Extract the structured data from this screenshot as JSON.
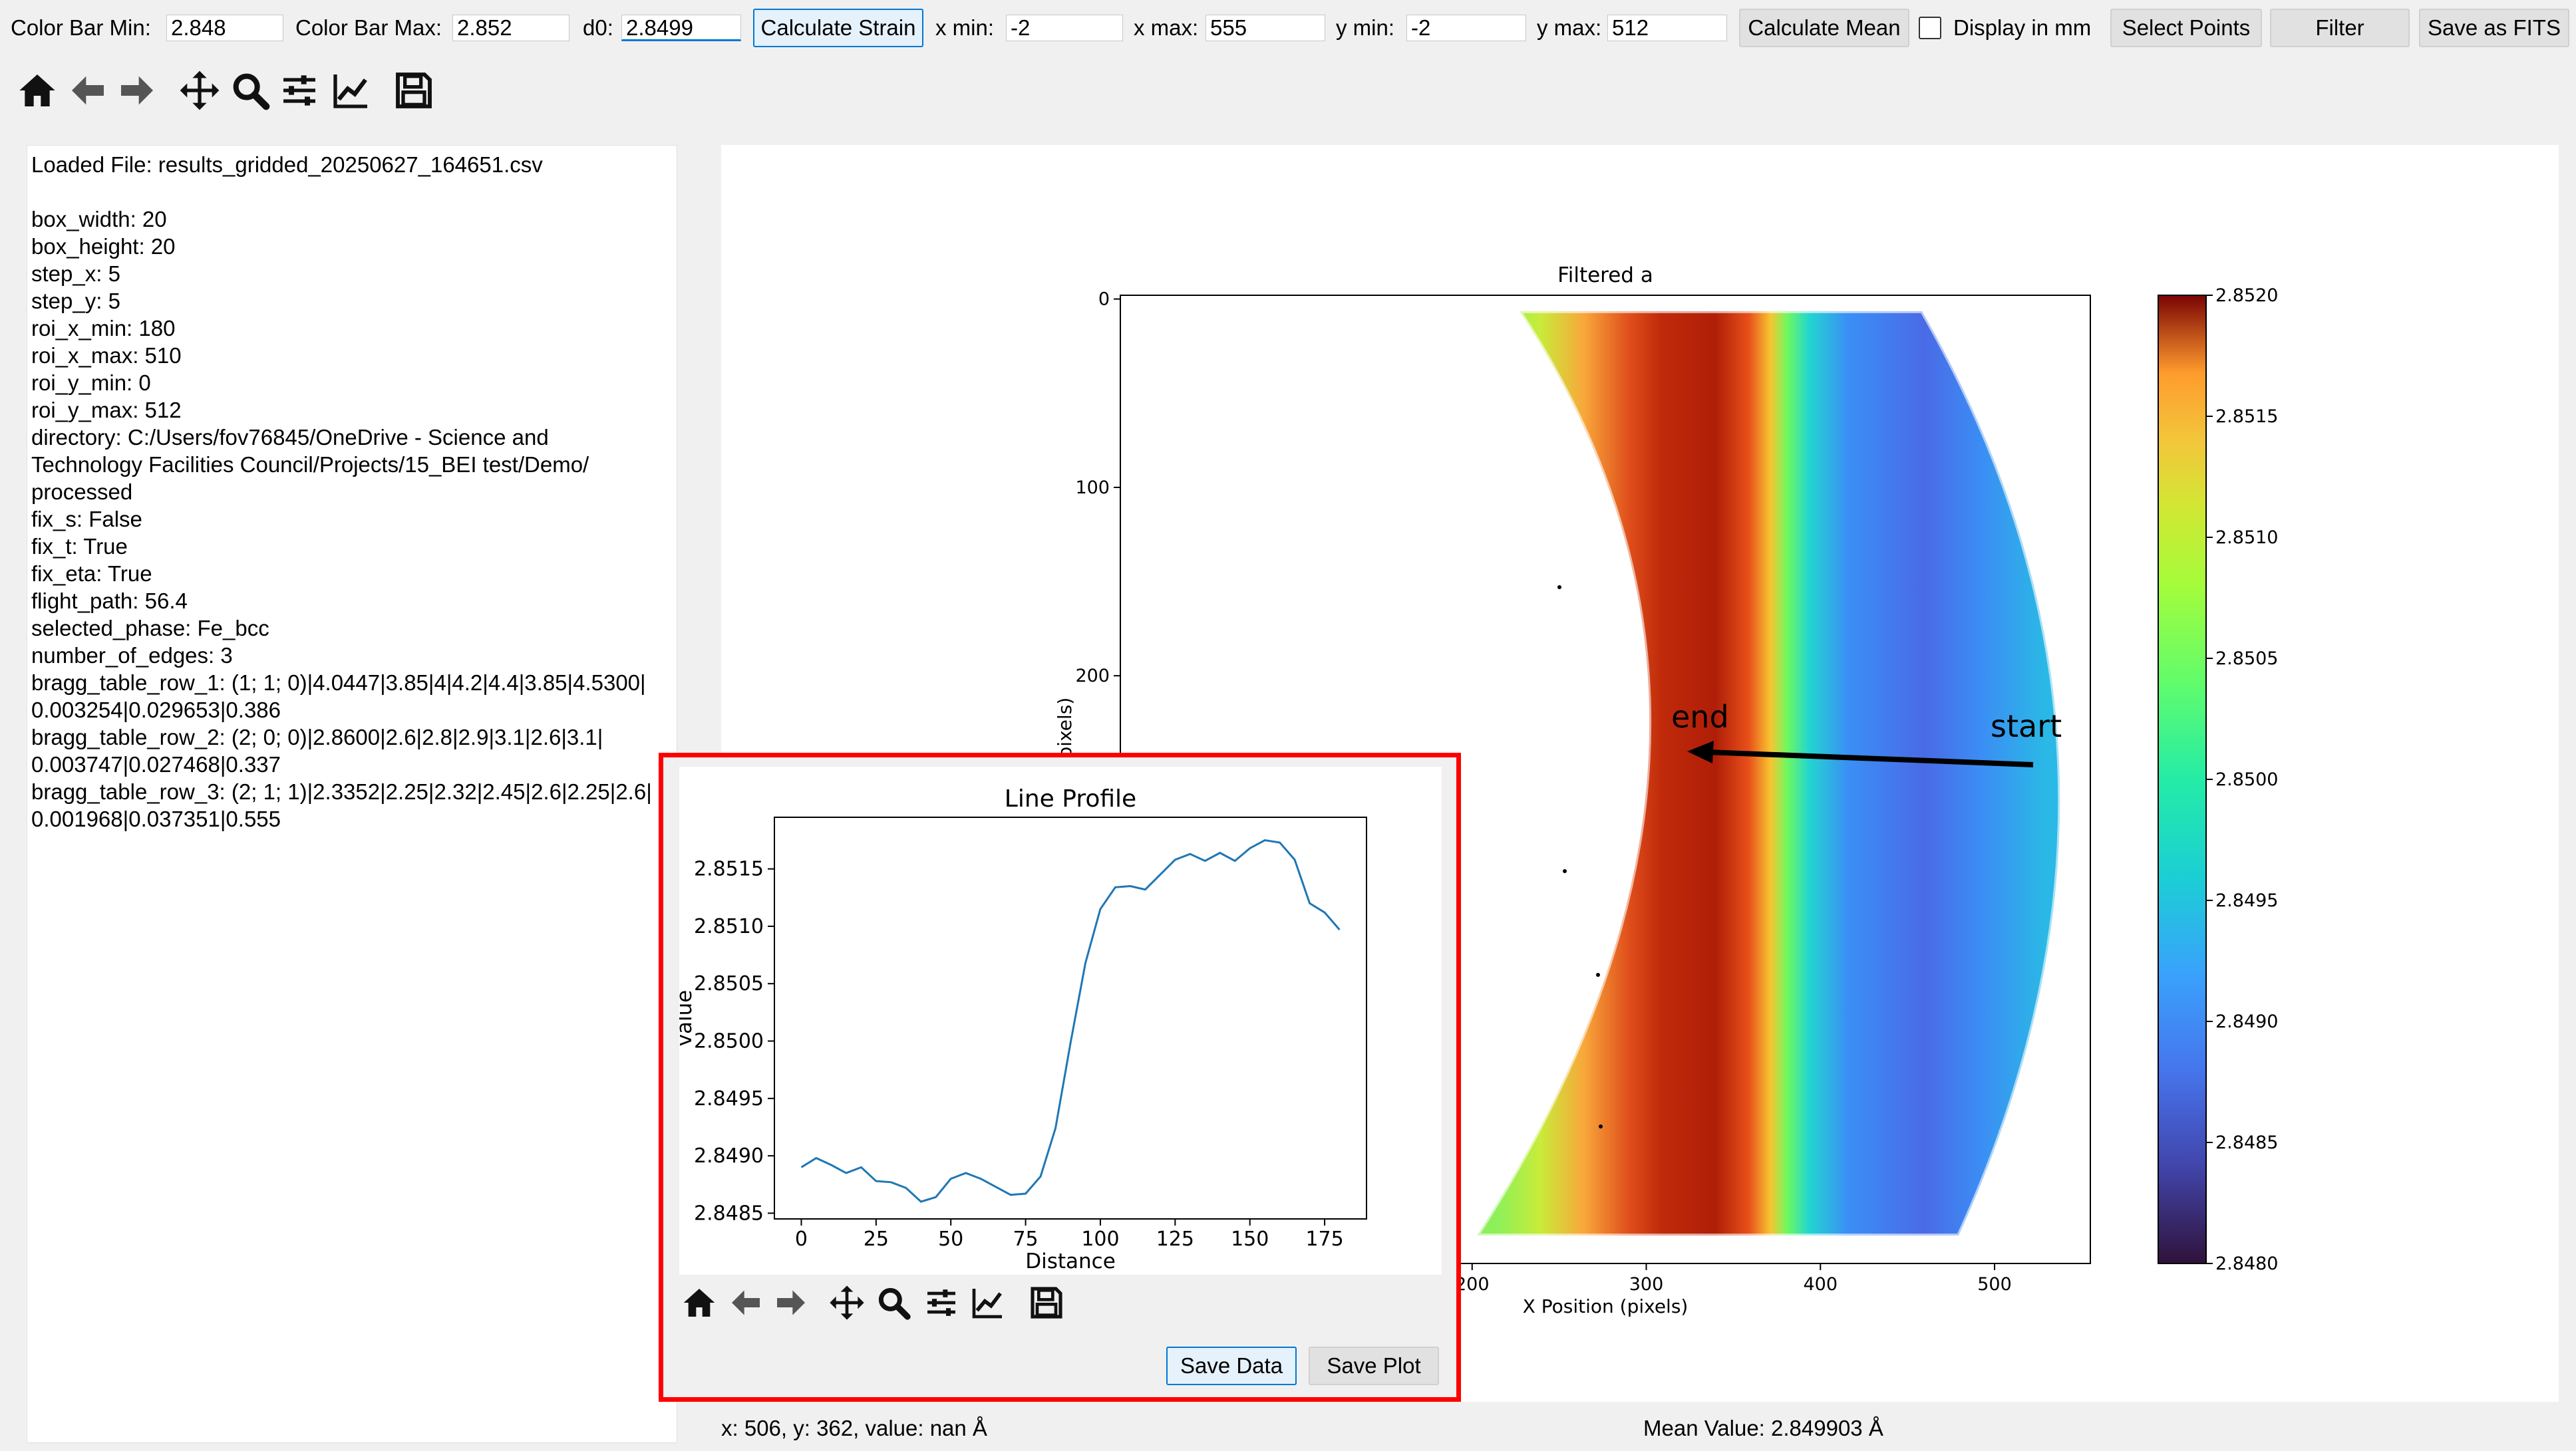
{
  "controls": {
    "color_bar_min_label": "Color Bar Min:",
    "color_bar_min_value": "2.848",
    "color_bar_max_label": "Color Bar Max:",
    "color_bar_max_value": "2.852",
    "d0_label": "d0:",
    "d0_value": "2.8499",
    "calculate_strain": "Calculate Strain",
    "x_min_label": "x min:",
    "x_min_value": "-2",
    "x_max_label": "x max:",
    "x_max_value": "555",
    "y_min_label": "y min:",
    "y_min_value": "-2",
    "y_max_label": "y max:",
    "y_max_value": "512",
    "calculate_mean": "Calculate Mean",
    "display_in_mm": "Display in mm",
    "display_in_mm_checked": false,
    "select_points": "Select Points",
    "filter": "Filter",
    "save_as_fits": "Save as FITS"
  },
  "toolbar": [
    "home-icon",
    "back-arrow-icon",
    "forward-arrow-icon",
    "pan-icon",
    "zoom-icon",
    "configure-subplots-icon",
    "edit-axis-icon",
    "save-icon"
  ],
  "info": {
    "lines": [
      "Loaded File: results_gridded_20250627_164651.csv",
      "",
      "box_width: 20",
      "box_height: 20",
      "step_x: 5",
      "step_y: 5",
      "roi_x_min: 180",
      "roi_x_max: 510",
      "roi_y_min: 0",
      "roi_y_max: 512",
      "directory: C:/Users/fov76845/OneDrive - Science and",
      "Technology Facilities Council/Projects/15_BEI test/Demo/",
      "processed",
      "fix_s: False",
      "fix_t: True",
      "fix_eta: True",
      "flight_path: 56.4",
      "selected_phase: Fe_bcc",
      "number_of_edges: 3",
      "bragg_table_row_1: (1; 1; 0)|4.0447|3.85|4|4.2|4.4|3.85|4.5300|",
      "0.003254|0.029653|0.386",
      "bragg_table_row_2: (2; 0; 0)|2.8600|2.6|2.8|2.9|3.1|2.6|3.1|",
      "0.003747|0.027468|0.337",
      "bragg_table_row_3: (2; 1; 1)|2.3352|2.25|2.32|2.45|2.6|2.25|2.6|",
      "0.001968|0.037351|0.555"
    ]
  },
  "main_plot": {
    "title": "Filtered a",
    "xlabel": "X Position (pixels)",
    "ylabel": "Y Position (pixels)",
    "x_ticks": [
      200,
      300,
      400,
      500
    ],
    "y_ticks": [
      0,
      100,
      200
    ],
    "xlim": [
      -2,
      555
    ],
    "ylim": [
      512,
      -2
    ],
    "annotation_start": "start",
    "annotation_end": "end",
    "colorbar": {
      "vmin": 2.848,
      "vmax": 2.852,
      "ticks": [
        "2.8520",
        "2.8515",
        "2.8510",
        "2.8505",
        "2.8500",
        "2.8495",
        "2.8490",
        "2.8485",
        "2.8480"
      ]
    }
  },
  "line_profile": {
    "save_data": "Save Data",
    "save_plot": "Save Plot"
  },
  "chart_data": {
    "type": "line",
    "title": "Line Profile",
    "xlabel": "Distance",
    "ylabel": "value",
    "xlim": [
      -9,
      189
    ],
    "ylim": [
      2.84845,
      2.85195
    ],
    "x_ticks": [
      0,
      25,
      50,
      75,
      100,
      125,
      150,
      175
    ],
    "y_ticks": [
      "2.8485",
      "2.8490",
      "2.8495",
      "2.8500",
      "2.8505",
      "2.8510",
      "2.8515"
    ],
    "x": [
      0,
      5,
      10,
      15,
      20,
      25,
      30,
      35,
      40,
      45,
      50,
      55,
      60,
      65,
      70,
      75,
      80,
      85,
      90,
      95,
      100,
      105,
      110,
      115,
      120,
      125,
      130,
      135,
      140,
      145,
      150,
      155,
      160,
      165,
      170,
      175,
      180
    ],
    "y": [
      2.8489,
      2.84898,
      2.84892,
      2.84885,
      2.8489,
      2.84878,
      2.84877,
      2.84872,
      2.8486,
      2.84864,
      2.8488,
      2.84885,
      2.8488,
      2.84873,
      2.84866,
      2.84867,
      2.84882,
      2.84924,
      2.84998,
      2.85068,
      2.85115,
      2.85134,
      2.85135,
      2.85132,
      2.85145,
      2.85158,
      2.85163,
      2.85157,
      2.85164,
      2.85157,
      2.85168,
      2.85175,
      2.85173,
      2.85158,
      2.8512,
      2.85112,
      2.85097
    ],
    "grid": false
  },
  "status": {
    "cursor": "x: 506, y: 362, value: nan Å",
    "mean": "Mean Value: 2.849903 Å"
  }
}
